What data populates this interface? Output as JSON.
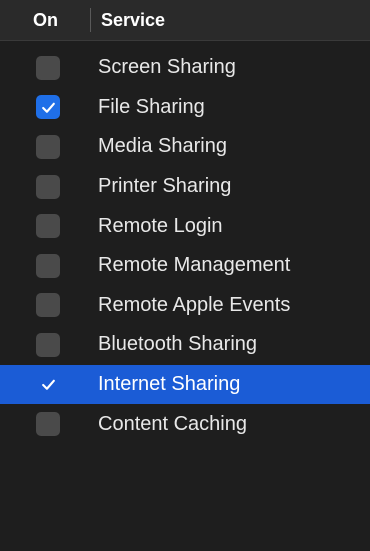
{
  "header": {
    "on_label": "On",
    "service_label": "Service"
  },
  "colors": {
    "background": "#1e1e1e",
    "header_background": "#2a2a2a",
    "selection": "#1b5cd6",
    "checkbox_checked": "#1f6fe8",
    "checkbox_unchecked": "#4a4a4a",
    "icon": "checkmark-icon"
  },
  "services": [
    {
      "label": "Screen Sharing",
      "checked": false,
      "selected": false
    },
    {
      "label": "File Sharing",
      "checked": true,
      "selected": false
    },
    {
      "label": "Media Sharing",
      "checked": false,
      "selected": false
    },
    {
      "label": "Printer Sharing",
      "checked": false,
      "selected": false
    },
    {
      "label": "Remote Login",
      "checked": false,
      "selected": false
    },
    {
      "label": "Remote Management",
      "checked": false,
      "selected": false
    },
    {
      "label": "Remote Apple Events",
      "checked": false,
      "selected": false
    },
    {
      "label": "Bluetooth Sharing",
      "checked": false,
      "selected": false
    },
    {
      "label": "Internet Sharing",
      "checked": true,
      "selected": true
    },
    {
      "label": "Content Caching",
      "checked": false,
      "selected": false
    }
  ]
}
